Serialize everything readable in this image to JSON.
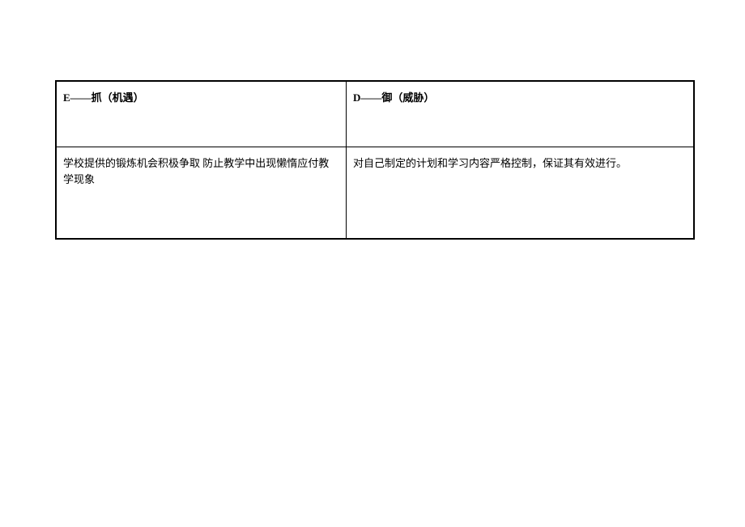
{
  "table": {
    "headers": {
      "left": "E——抓（机遇）",
      "right": "D——御（威胁）"
    },
    "content": {
      "left": "学校提供的锻炼机会积极争取 防止教学中出现懒惰应付教学现象",
      "right": "对自己制定的计划和学习内容严格控制，保证其有效进行。"
    }
  }
}
